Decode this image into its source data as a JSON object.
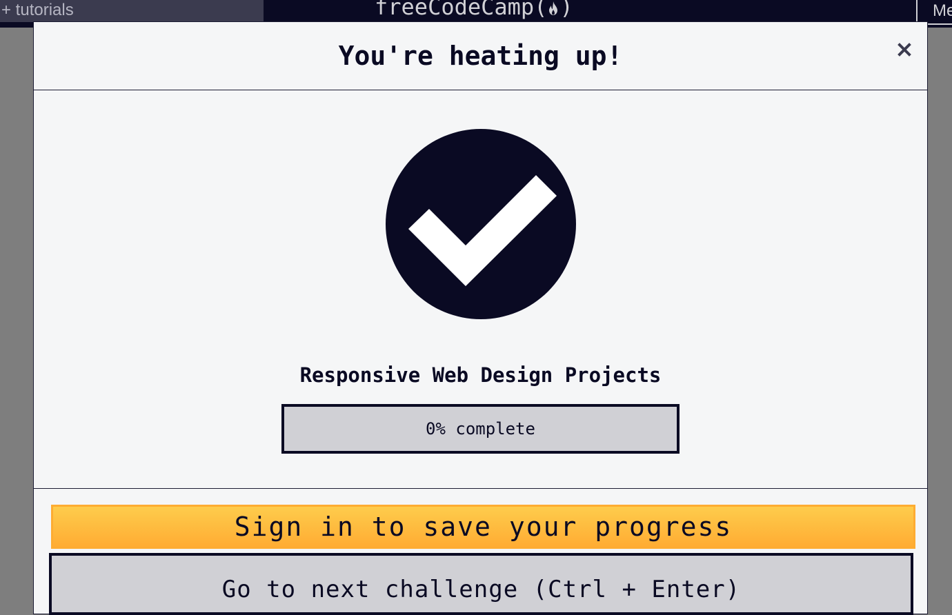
{
  "navbar": {
    "search_text": "+ tutorials",
    "logo_text": "freeCodeCamp(",
    "logo_close": ")",
    "menu_label": "Menu"
  },
  "modal": {
    "title": "You're heating up!",
    "close_symbol": "×",
    "block_name": "Responsive Web Design Projects",
    "progress_percent": 0,
    "progress_text": "0% complete",
    "signin_label": "Sign in to save your progress",
    "next_label": "Go to next challenge (Ctrl + Enter)"
  },
  "icons": {
    "check": "check-circle-icon",
    "close": "close-icon",
    "flame": "flame-icon"
  },
  "colors": {
    "dark": "#0a0a23",
    "modal_bg": "#f5f6f7",
    "signin_top": "#fecc4c",
    "signin_bottom": "#ffac33",
    "gray": "#d0d0d5"
  }
}
